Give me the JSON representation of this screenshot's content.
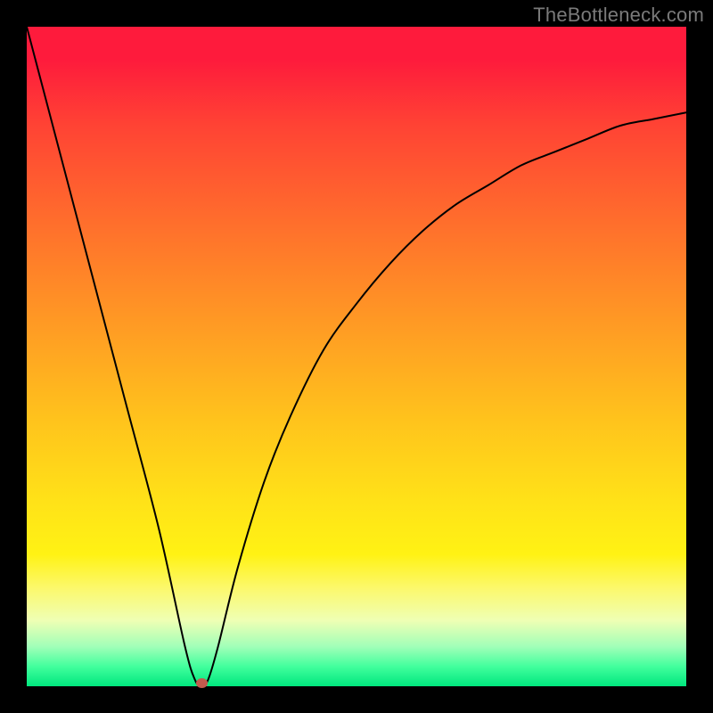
{
  "watermark": "TheBottleneck.com",
  "chart_data": {
    "type": "line",
    "title": "",
    "xlabel": "",
    "ylabel": "",
    "x_range": [
      0,
      1
    ],
    "y_range": [
      0,
      1
    ],
    "legend": false,
    "grid": false,
    "background_gradient": {
      "top": "#fe1b3c",
      "bottom": "#00e77e",
      "stops": [
        "red",
        "orange",
        "yellow",
        "green"
      ]
    },
    "series": [
      {
        "name": "bottleneck-curve",
        "type": "line",
        "color": "#000000",
        "x": [
          0.0,
          0.05,
          0.1,
          0.15,
          0.2,
          0.24,
          0.255,
          0.265,
          0.275,
          0.29,
          0.32,
          0.36,
          0.4,
          0.45,
          0.5,
          0.55,
          0.6,
          0.65,
          0.7,
          0.75,
          0.8,
          0.85,
          0.9,
          0.95,
          1.0
        ],
        "y": [
          1.0,
          0.81,
          0.62,
          0.43,
          0.24,
          0.06,
          0.01,
          0.0,
          0.01,
          0.06,
          0.18,
          0.31,
          0.41,
          0.51,
          0.58,
          0.64,
          0.69,
          0.73,
          0.76,
          0.79,
          0.81,
          0.83,
          0.85,
          0.86,
          0.87
        ]
      },
      {
        "name": "optimal-point",
        "type": "scatter",
        "color": "#c25a4e",
        "x": [
          0.265
        ],
        "y": [
          0.005
        ]
      }
    ],
    "notes": "V-shaped bottleneck curve. Left branch descends roughly linearly from (0,1) to a minimum near x≈0.265, y≈0; right branch rises concavely toward (1,≈0.87). Single marker at the minimum."
  }
}
